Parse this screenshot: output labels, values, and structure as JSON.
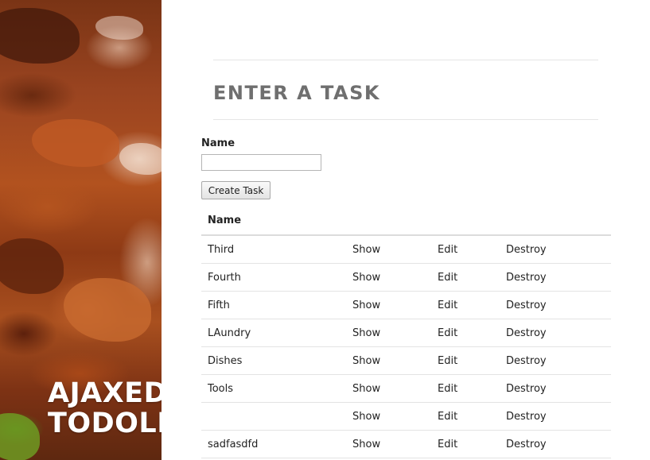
{
  "sidebar": {
    "title_line1": "AJAXED",
    "title_line2": "TODOLIST"
  },
  "main": {
    "heading": "ENTER A TASK",
    "form": {
      "name_label": "Name",
      "name_value": "",
      "name_placeholder": "",
      "submit_label": "Create Task"
    },
    "table": {
      "header_name": "Name",
      "rows": [
        {
          "name": "Third",
          "show": "Show",
          "edit": "Edit",
          "destroy": "Destroy"
        },
        {
          "name": "Fourth",
          "show": "Show",
          "edit": "Edit",
          "destroy": "Destroy"
        },
        {
          "name": "Fifth",
          "show": "Show",
          "edit": "Edit",
          "destroy": "Destroy"
        },
        {
          "name": "LAundry",
          "show": "Show",
          "edit": "Edit",
          "destroy": "Destroy"
        },
        {
          "name": "Dishes",
          "show": "Show",
          "edit": "Edit",
          "destroy": "Destroy"
        },
        {
          "name": "Tools",
          "show": "Show",
          "edit": "Edit",
          "destroy": "Destroy"
        },
        {
          "name": "",
          "show": "Show",
          "edit": "Edit",
          "destroy": "Destroy"
        },
        {
          "name": "sadfasdfd",
          "show": "Show",
          "edit": "Edit",
          "destroy": "Destroy"
        }
      ]
    }
  },
  "colors": {
    "heading": "#6f6f6f",
    "rock_orange": "#b2521f",
    "rock_dark": "#5e2810"
  }
}
